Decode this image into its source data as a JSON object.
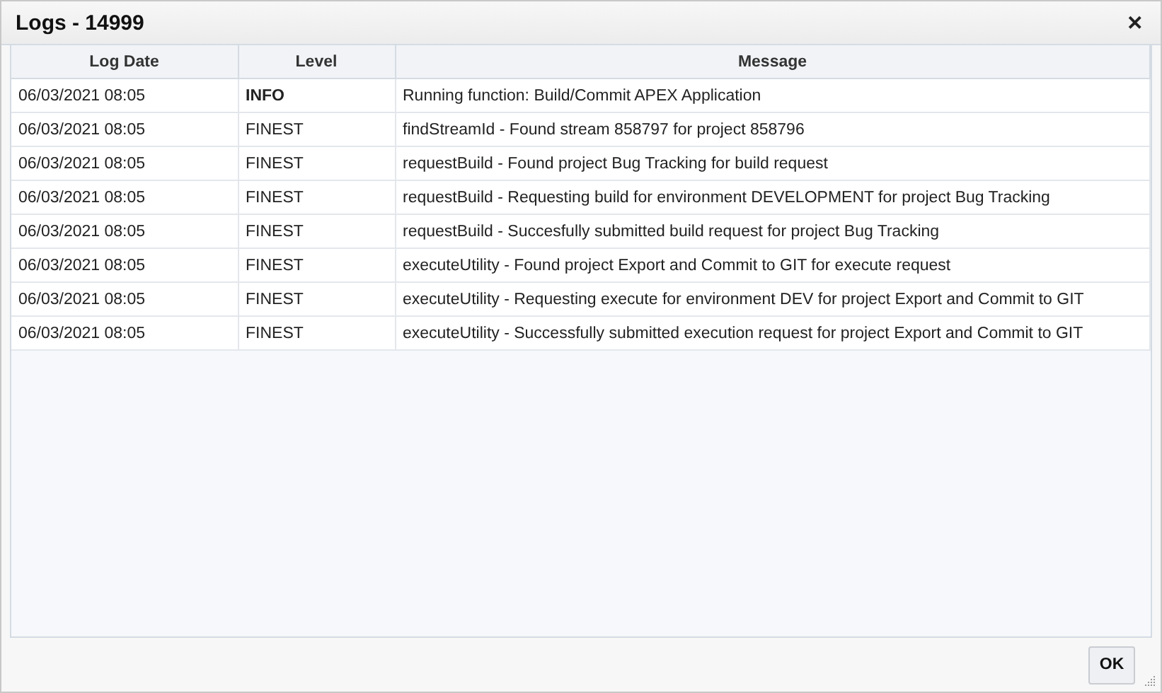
{
  "window": {
    "title": "Logs - 14999",
    "close": "✕"
  },
  "table": {
    "columns": [
      "Log Date",
      "Level",
      "Message"
    ],
    "rows": [
      {
        "date": "06/03/2021 08:05",
        "level": "INFO",
        "bold": true,
        "message": "Running function: Build/Commit APEX Application"
      },
      {
        "date": "06/03/2021 08:05",
        "level": "FINEST",
        "bold": false,
        "message": "findStreamId - Found stream 858797 for project 858796"
      },
      {
        "date": "06/03/2021 08:05",
        "level": "FINEST",
        "bold": false,
        "message": "requestBuild - Found project Bug Tracking for build request"
      },
      {
        "date": "06/03/2021 08:05",
        "level": "FINEST",
        "bold": false,
        "message": "requestBuild - Requesting build for environment DEVELOPMENT for project Bug Tracking"
      },
      {
        "date": "06/03/2021 08:05",
        "level": "FINEST",
        "bold": false,
        "message": "requestBuild - Succesfully submitted build request for project Bug Tracking"
      },
      {
        "date": "06/03/2021 08:05",
        "level": "FINEST",
        "bold": false,
        "message": "executeUtility - Found project Export and Commit to GIT for execute request"
      },
      {
        "date": "06/03/2021 08:05",
        "level": "FINEST",
        "bold": false,
        "message": "executeUtility - Requesting execute for environment DEV for project Export and Commit to GIT"
      },
      {
        "date": "06/03/2021 08:05",
        "level": "FINEST",
        "bold": false,
        "message": "executeUtility - Successfully submitted execution request for project Export and Commit to GIT"
      }
    ]
  },
  "buttons": [
    "OK"
  ]
}
